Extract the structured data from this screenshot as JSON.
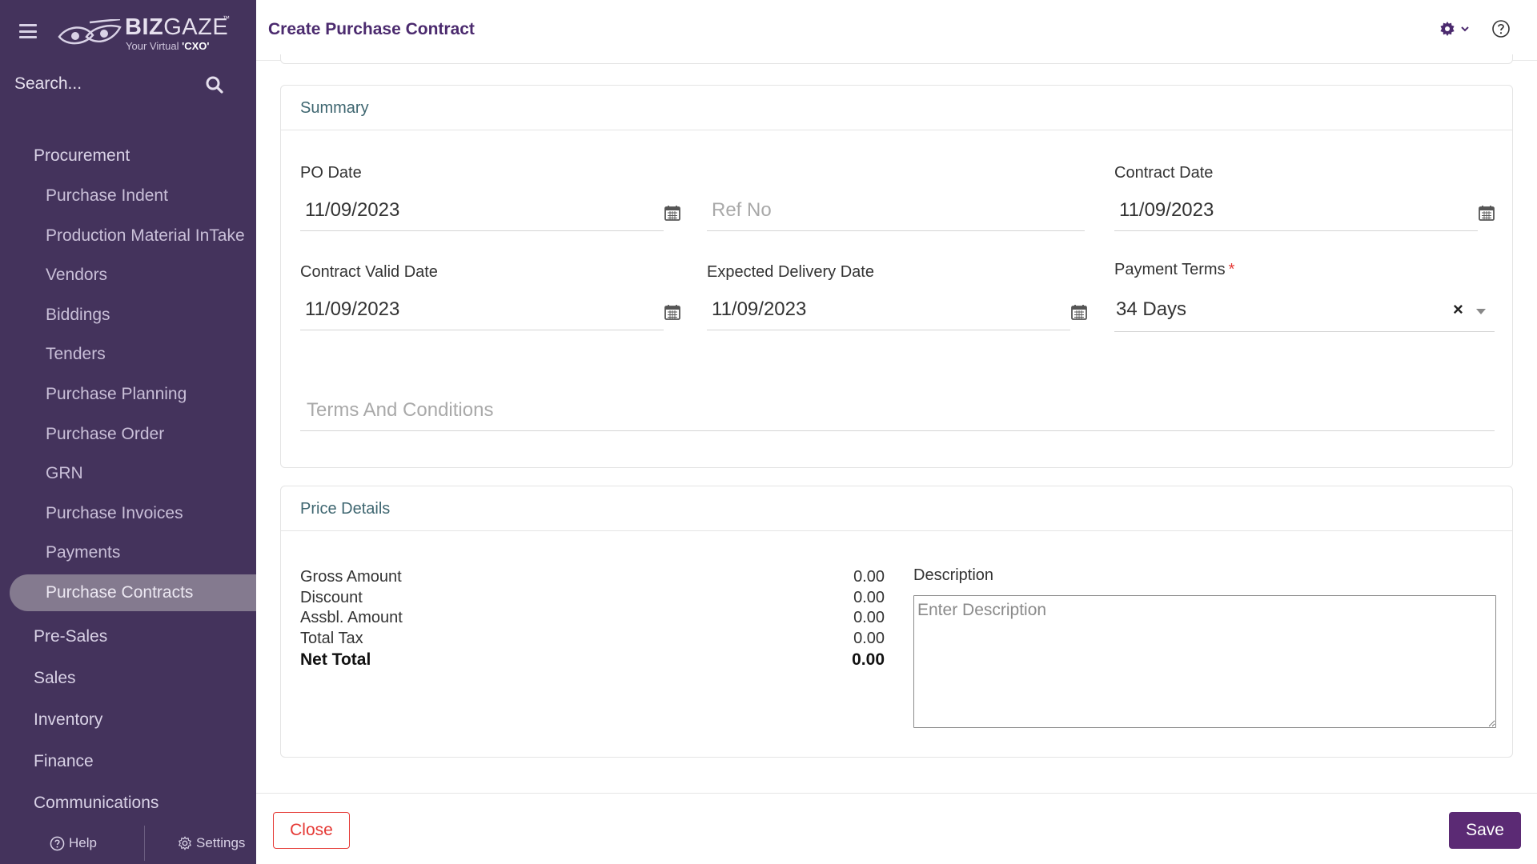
{
  "brand": {
    "name_bold": "BIZ",
    "name_light": "GAZE",
    "trademark": "™",
    "tagline_prefix": "Your Virtual",
    "tagline_bold": "'CXO'"
  },
  "sidebar": {
    "search_placeholder": "Search...",
    "menu": [
      {
        "label": "Procurement",
        "kind": "group"
      },
      {
        "label": "Purchase Indent",
        "kind": "sub"
      },
      {
        "label": "Production Material InTake",
        "kind": "sub"
      },
      {
        "label": "Vendors",
        "kind": "sub"
      },
      {
        "label": "Biddings",
        "kind": "sub"
      },
      {
        "label": "Tenders",
        "kind": "sub"
      },
      {
        "label": "Purchase Planning",
        "kind": "sub"
      },
      {
        "label": "Purchase Order",
        "kind": "sub"
      },
      {
        "label": "GRN",
        "kind": "sub"
      },
      {
        "label": "Purchase Invoices",
        "kind": "sub"
      },
      {
        "label": "Payments",
        "kind": "sub"
      },
      {
        "label": "Purchase Contracts",
        "kind": "sub",
        "active": true
      },
      {
        "label": "Pre-Sales",
        "kind": "group"
      },
      {
        "label": "Sales",
        "kind": "group"
      },
      {
        "label": "Inventory",
        "kind": "group"
      },
      {
        "label": "Finance",
        "kind": "group"
      },
      {
        "label": "Communications",
        "kind": "group"
      }
    ],
    "footer": {
      "help_label": "Help",
      "settings_label": "Settings"
    }
  },
  "header": {
    "title": "Create Purchase Contract"
  },
  "summary": {
    "title": "Summary",
    "po_date": {
      "label": "PO Date",
      "value": "11/09/2023"
    },
    "ref_no": {
      "placeholder": "Ref No",
      "value": ""
    },
    "contract_date": {
      "label": "Contract Date",
      "value": "11/09/2023"
    },
    "contract_valid_date": {
      "label": "Contract Valid Date",
      "value": "11/09/2023"
    },
    "expected_delivery_date": {
      "label": "Expected Delivery Date",
      "value": "11/09/2023"
    },
    "payment_terms": {
      "label": "Payment Terms",
      "required_mark": "*",
      "value": "34 Days"
    },
    "terms_and_conditions": {
      "placeholder": "Terms And Conditions",
      "value": ""
    }
  },
  "price_details": {
    "title": "Price Details",
    "rows": [
      {
        "label": "Gross Amount",
        "value": "0.00"
      },
      {
        "label": "Discount",
        "value": "0.00"
      },
      {
        "label": "Assbl. Amount",
        "value": "0.00"
      },
      {
        "label": "Total Tax",
        "value": "0.00"
      },
      {
        "label": "Net Total",
        "value": "0.00",
        "bold": true
      }
    ],
    "description": {
      "label": "Description",
      "placeholder": "Enter Description",
      "value": ""
    }
  },
  "actions": {
    "close_label": "Close",
    "save_label": "Save"
  },
  "colors": {
    "sidebar_bg": "#44335c",
    "active_item_bg": "#847a8f",
    "title_purple": "#4b2a6e",
    "save_bg": "#5b2a74",
    "close_red": "#e53935",
    "section_title": "#3e6670"
  },
  "icons": {
    "menu": "hamburger-icon",
    "search": "search-icon",
    "calendar": "calendar-icon",
    "gear": "gear-icon",
    "help": "help-circle-icon",
    "clear": "clear-x-icon",
    "caret": "caret-down-icon"
  }
}
